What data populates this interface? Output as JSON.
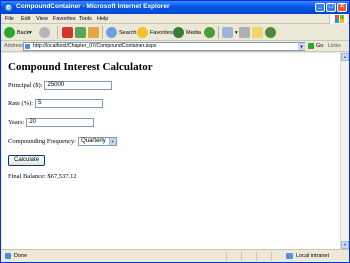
{
  "window": {
    "title": "CompoundContainer - Microsoft Internet Explorer"
  },
  "menu": {
    "items": [
      "File",
      "Edit",
      "View",
      "Favorites",
      "Tools",
      "Help"
    ]
  },
  "toolbar": {
    "back_label": "Back",
    "search_label": "Search",
    "favorites_label": "Favorites",
    "media_label": "Media"
  },
  "address": {
    "label": "Address",
    "url": "http://localhost/Chapter_07/CompoundContainer.aspx",
    "go_label": "Go",
    "links_label": "Links"
  },
  "page": {
    "title": "Compound Interest Calculator",
    "principal_label": "Principal ($):",
    "principal_value": "25000",
    "rate_label": "Rate (%):",
    "rate_value": "5",
    "years_label": "Years:",
    "years_value": "20",
    "frequency_label": "Compounding Frequency:",
    "frequency_value": "Quarterly",
    "calculate_label": "Calculate",
    "result_text": "Final Balance: $67,537.12"
  },
  "status": {
    "text": "Done",
    "zone": "Local intranet"
  },
  "colors": {
    "titlebar": "#0055e5",
    "chrome": "#ece9d8",
    "input_border": "#7f9db9",
    "close_button": "#e45a2c"
  }
}
